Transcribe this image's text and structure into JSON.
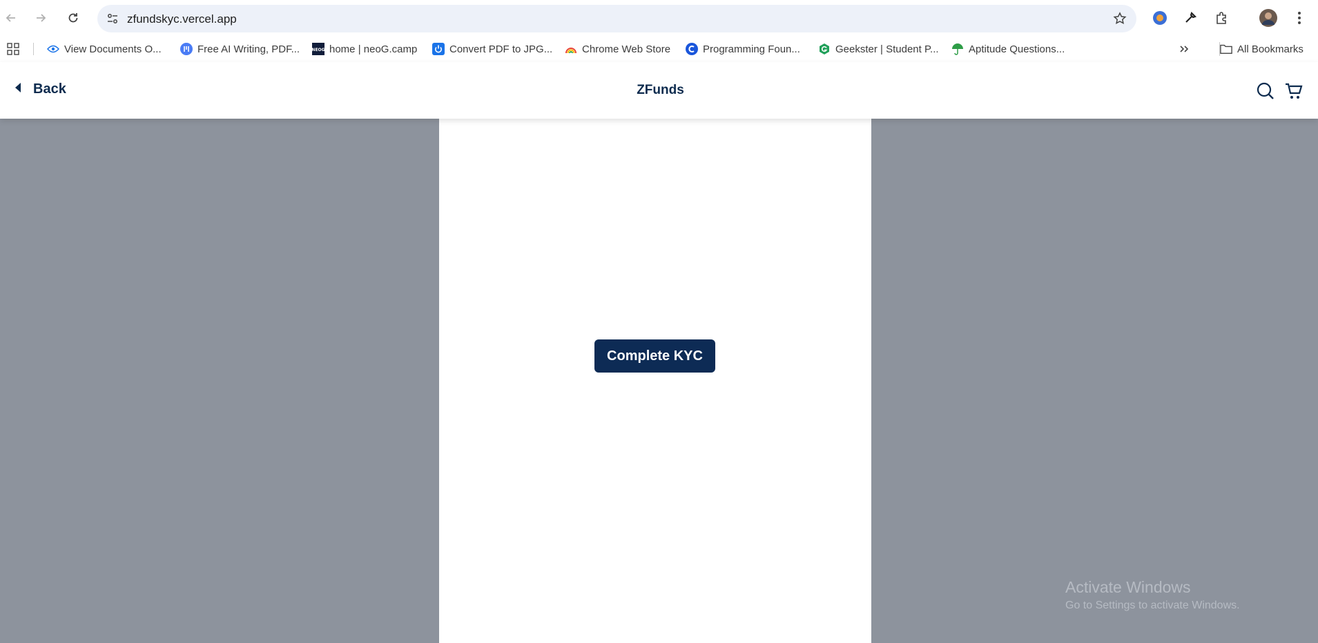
{
  "browser": {
    "url": "zfundskyc.vercel.app",
    "bookmarks": [
      {
        "label": "View Documents O...",
        "icon": "eye-icon"
      },
      {
        "label": "Free AI Writing, PDF...",
        "icon": "writing-app-icon"
      },
      {
        "label": "home | neoG.camp",
        "icon": "neog-icon"
      },
      {
        "label": "Convert PDF to JPG...",
        "icon": "power-icon"
      },
      {
        "label": "Chrome Web Store",
        "icon": "rainbow-icon"
      },
      {
        "label": "Programming Foun...",
        "icon": "c-logo-icon"
      },
      {
        "label": "Geekster | Student P...",
        "icon": "g-logo-icon"
      },
      {
        "label": "Aptitude Questions...",
        "icon": "umbrella-icon"
      }
    ],
    "all_bookmarks_label": "All Bookmarks"
  },
  "app": {
    "back_label": "Back",
    "title": "ZFunds",
    "primary_color": "#0d2b55"
  },
  "main": {
    "kyc_button_label": "Complete KYC"
  },
  "watermark": {
    "line1": "Activate Windows",
    "line2": "Go to Settings to activate Windows."
  }
}
